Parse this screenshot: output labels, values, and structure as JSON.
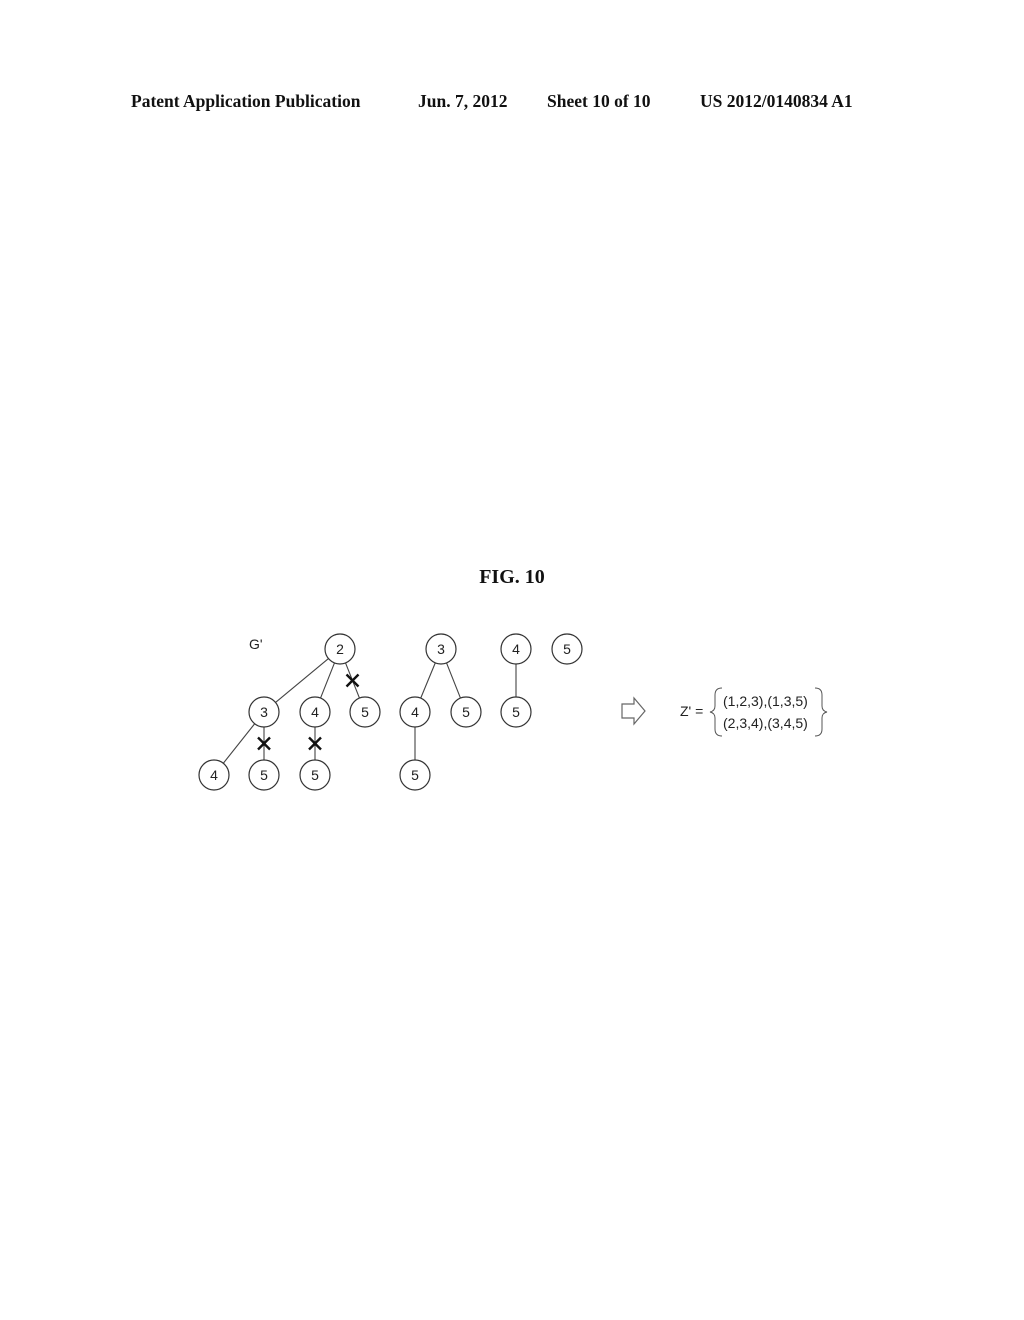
{
  "header": {
    "publication": "Patent Application Publication",
    "date": "Jun. 7, 2012",
    "sheet": "Sheet 10 of 10",
    "number": "US 2012/0140834 A1"
  },
  "figure": {
    "title": "FIG. 10",
    "graph_label": "G'",
    "nodes": [
      {
        "id": "a2",
        "label": "2",
        "row": 0,
        "col": 2.52
      },
      {
        "id": "b3",
        "label": "3",
        "row": 0,
        "col": 4.54
      },
      {
        "id": "c4",
        "label": "4",
        "row": 0,
        "col": 6.04
      },
      {
        "id": "d5",
        "label": "5",
        "row": 0,
        "col": 7.06
      },
      {
        "id": "a2_3",
        "label": "3",
        "row": 1,
        "col": 1.0
      },
      {
        "id": "a2_4",
        "label": "4",
        "row": 1,
        "col": 2.02
      },
      {
        "id": "a2_5",
        "label": "5",
        "row": 1,
        "col": 3.02
      },
      {
        "id": "b3_4",
        "label": "4",
        "row": 1,
        "col": 4.02
      },
      {
        "id": "b3_5",
        "label": "5",
        "row": 1,
        "col": 5.04
      },
      {
        "id": "c4_5",
        "label": "5",
        "row": 1,
        "col": 6.04
      },
      {
        "id": "a2_3_4",
        "label": "4",
        "row": 2,
        "col": 0.0
      },
      {
        "id": "a2_3_5",
        "label": "5",
        "row": 2,
        "col": 1.0
      },
      {
        "id": "a2_4_5",
        "label": "5",
        "row": 2,
        "col": 2.02
      },
      {
        "id": "b3_4_5",
        "label": "5",
        "row": 2,
        "col": 4.02
      }
    ],
    "edges": [
      {
        "from": "a2",
        "to": "a2_3",
        "pruned": false
      },
      {
        "from": "a2",
        "to": "a2_4",
        "pruned": false
      },
      {
        "from": "a2",
        "to": "a2_5",
        "pruned": true
      },
      {
        "from": "a2_3",
        "to": "a2_3_4",
        "pruned": false
      },
      {
        "from": "a2_3",
        "to": "a2_3_5",
        "pruned": true
      },
      {
        "from": "a2_4",
        "to": "a2_4_5",
        "pruned": true
      },
      {
        "from": "b3",
        "to": "b3_4",
        "pruned": false
      },
      {
        "from": "b3",
        "to": "b3_5",
        "pruned": false
      },
      {
        "from": "b3_4",
        "to": "b3_4_5",
        "pruned": false
      },
      {
        "from": "c4",
        "to": "c4_5",
        "pruned": false
      }
    ],
    "result": {
      "label": "Z' =",
      "line1": "(1,2,3),(1,3,5)",
      "line2": "(2,3,4),(3,4,5)"
    }
  }
}
